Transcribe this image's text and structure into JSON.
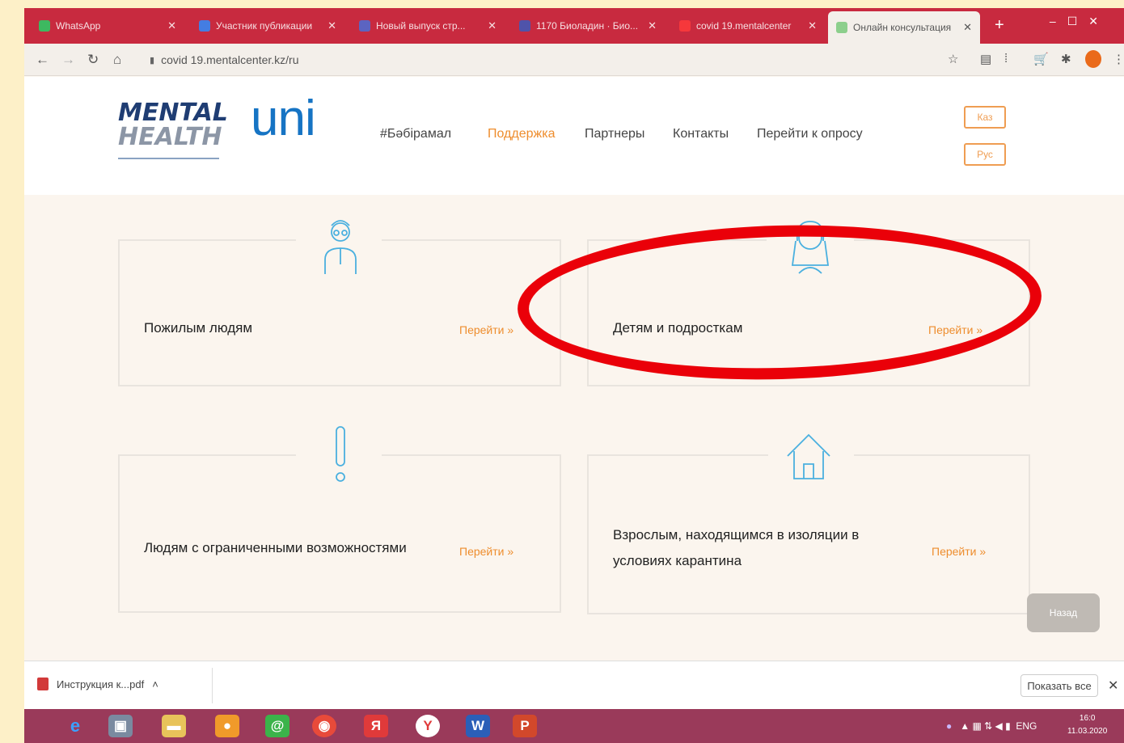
{
  "browser": {
    "tabs": [
      {
        "title": "WhatsApp",
        "active": false
      },
      {
        "title": "Участник публикации",
        "active": false
      },
      {
        "title": "Новый выпуск стр...",
        "active": false
      },
      {
        "title": "1170 Биоладин · Био...",
        "active": false
      },
      {
        "title": "covid 19.mentalcenter",
        "active": false
      },
      {
        "title": "Онлайн консультация",
        "active": true
      }
    ],
    "new_tab": "+",
    "url": "covid 19.mentalcenter.kz/ru"
  },
  "site": {
    "logo_line1": "MENTAL",
    "logo_line2": "HEALTH",
    "partner_logo": "uni",
    "nav": [
      {
        "label": "#Бәбірамал",
        "active": false
      },
      {
        "label": "Поддержка",
        "active": true
      },
      {
        "label": "Партнеры",
        "active": false
      },
      {
        "label": "Контакты",
        "active": false
      },
      {
        "label": "Перейти к опросу",
        "active": false
      }
    ],
    "lang_buttons": [
      "Каз",
      "Рус"
    ]
  },
  "cards": [
    {
      "label": "Пожилым людям",
      "link": "Перейти »"
    },
    {
      "label": "Детям и подросткам",
      "link": "Перейти »"
    },
    {
      "label": "Людям с ограниченными возможностями",
      "link": "Перейти »"
    },
    {
      "label_line1": "Взрослым, находящимся в изоляции в",
      "label_line2": "условиях карантина",
      "link": "Перейти »"
    }
  ],
  "back_button": "Назад",
  "downloads": {
    "file": "Инструкция к...pdf",
    "show_all": "Показать все"
  },
  "taskbar": {
    "lang": "ENG",
    "time": "16:0",
    "date": "11.03.2020"
  },
  "colors": {
    "accent_orange": "#ee8d2d",
    "logo_blue": "#1f3d73",
    "uni_blue": "#1674c4",
    "icon_blue": "#4ab0df",
    "highlight_red": "#ea0009"
  }
}
